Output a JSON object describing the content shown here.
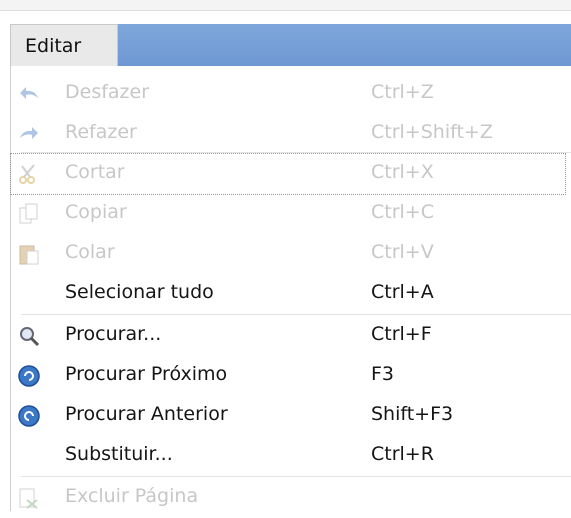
{
  "menu": {
    "title": "Editar",
    "items": [
      {
        "label": "Desfazer",
        "shortcut": "Ctrl+Z",
        "enabled": false,
        "icon": "undo-icon"
      },
      {
        "label": "Refazer",
        "shortcut": "Ctrl+Shift+Z",
        "enabled": false,
        "icon": "redo-icon"
      },
      {
        "label": "Cortar",
        "shortcut": "Ctrl+X",
        "enabled": false,
        "icon": "cut-icon"
      },
      {
        "label": "Copiar",
        "shortcut": "Ctrl+C",
        "enabled": false,
        "icon": "copy-icon"
      },
      {
        "label": "Colar",
        "shortcut": "Ctrl+V",
        "enabled": false,
        "icon": "paste-icon"
      },
      {
        "label": "Selecionar tudo",
        "shortcut": "Ctrl+A",
        "enabled": true,
        "icon": ""
      },
      {
        "label": "Procurar...",
        "shortcut": "Ctrl+F",
        "enabled": true,
        "icon": "find-icon"
      },
      {
        "label": "Procurar Próximo",
        "shortcut": "F3",
        "enabled": true,
        "icon": "find-next-icon"
      },
      {
        "label": "Procurar Anterior",
        "shortcut": "Shift+F3",
        "enabled": true,
        "icon": "find-previous-icon"
      },
      {
        "label": "Substituir...",
        "shortcut": "Ctrl+R",
        "enabled": true,
        "icon": ""
      },
      {
        "label": "Excluir Página",
        "shortcut": "",
        "enabled": false,
        "icon": "delete-page-icon"
      }
    ]
  },
  "colors": {
    "highlight": "#7ea7dc",
    "enabled_text": "#151515",
    "disabled_text": "#c7c7c7"
  }
}
